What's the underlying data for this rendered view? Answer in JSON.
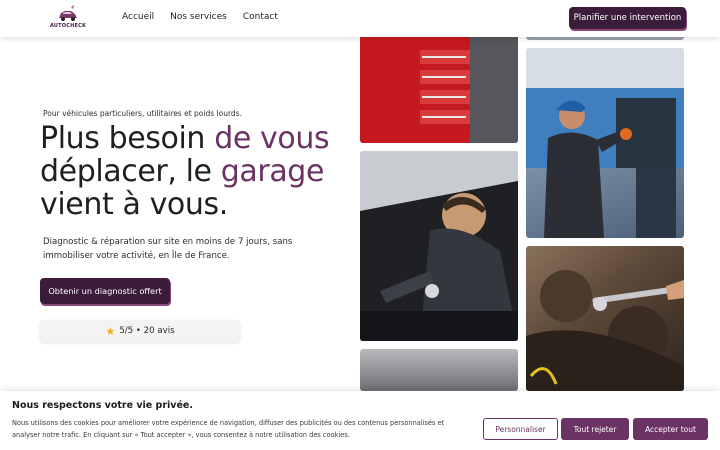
{
  "brand": {
    "name": "AUTOCHECK",
    "accent_color": "#6b3264",
    "dark_color": "#3b1d3b"
  },
  "nav": {
    "items": [
      "Accueil",
      "Nos services",
      "Contact"
    ]
  },
  "header": {
    "cta_label": "Planifier une intervention"
  },
  "hero": {
    "subtitle": "Pour véhicules particuliers, utilitaires et poids lourds.",
    "title_part1": "Plus besoin ",
    "title_accent1": "de vous",
    "title_part2": "déplacer, ",
    "title_part3": "le ",
    "title_accent2": "garage",
    "title_part4": "vient à vous.",
    "description": "Diagnostic & réparation sur site en moins de 7 jours, sans immobiliser votre activité, en Île de France.",
    "cta_label": "Obtenir un diagnostic offert",
    "rating_icon": "star-icon",
    "rating_text": "5/5 • 20 avis"
  },
  "photos": [
    {
      "name": "photo-red-tool-cabinet"
    },
    {
      "name": "photo-top-right"
    },
    {
      "name": "photo-mechanic-blue-cap"
    },
    {
      "name": "photo-mechanic-engine-bay"
    },
    {
      "name": "photo-engine-wrench"
    },
    {
      "name": "photo-bottom"
    }
  ],
  "cookie": {
    "title": "Nous respectons votre vie privée.",
    "text": "Nous utilisons des cookies pour améliorer votre expérience de navigation, diffuser des publicités ou des contenus personnalisés et analyser notre trafic. En cliquant sur « Tout accepter », vous consentez à notre utilisation des cookies.",
    "customize_label": "Personnaliser",
    "reject_label": "Tout rejeter",
    "accept_label": "Accepter tout"
  }
}
